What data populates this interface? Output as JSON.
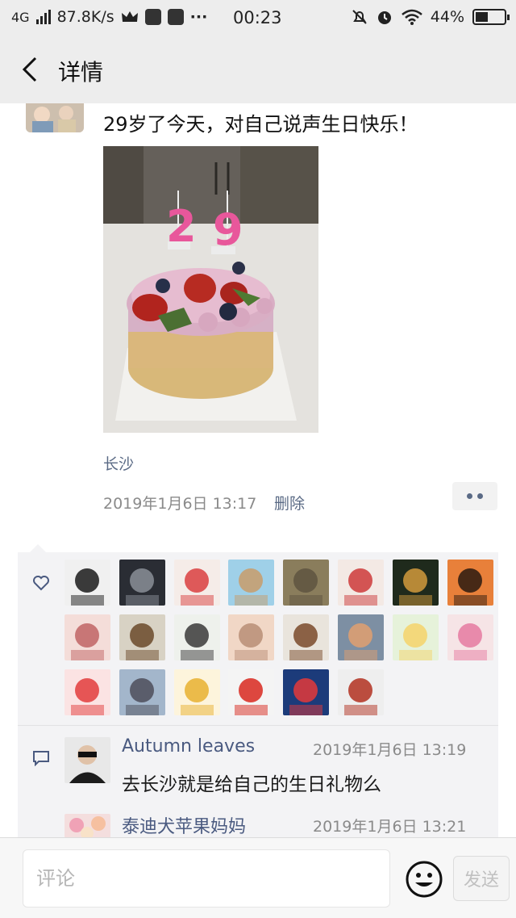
{
  "status_bar": {
    "network": "4G",
    "speed": "87.8K/s",
    "more": "···",
    "time": "00:23",
    "battery": "44%",
    "battery_level": 0.44
  },
  "nav": {
    "title": "详情"
  },
  "post": {
    "text": "29岁了今天，对自己说声生日快乐！",
    "photo_candle_1": "2",
    "photo_candle_2": "9",
    "location": "长沙",
    "timestamp": "2019年1月6日 13:17",
    "delete_label": "删除"
  },
  "likes": {
    "count": 22
  },
  "comments": [
    {
      "name": "Autumn leaves",
      "time": "2019年1月6日 13:19",
      "text": "去长沙就是给自己的生日礼物么"
    },
    {
      "name": "泰迪犬苹果妈妈",
      "time": "2019年1月6日 13:21",
      "text": ""
    }
  ],
  "input": {
    "placeholder": "评论",
    "send_label": "发送"
  },
  "colors": {
    "link": "#5a6a85",
    "name": "#4a5a80",
    "panel_bg": "#f3f3f5",
    "header_bg": "#ededed"
  }
}
